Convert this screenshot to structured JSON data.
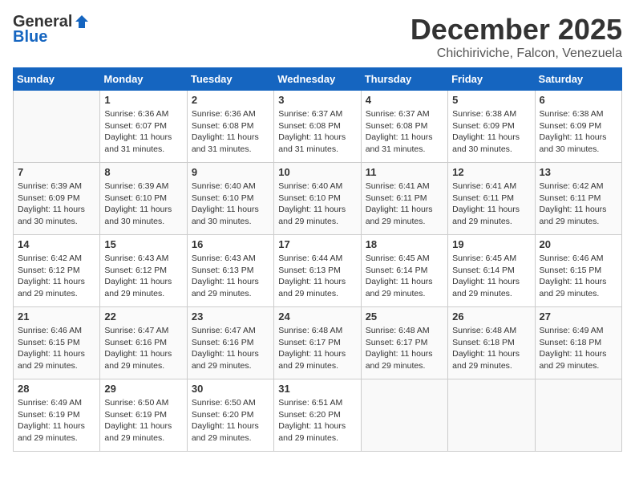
{
  "logo": {
    "general": "General",
    "blue": "Blue"
  },
  "header": {
    "month": "December 2025",
    "location": "Chichiriviche, Falcon, Venezuela"
  },
  "weekdays": [
    "Sunday",
    "Monday",
    "Tuesday",
    "Wednesday",
    "Thursday",
    "Friday",
    "Saturday"
  ],
  "weeks": [
    [
      {
        "day": "",
        "sunrise": "",
        "sunset": "",
        "daylight": ""
      },
      {
        "day": "1",
        "sunrise": "Sunrise: 6:36 AM",
        "sunset": "Sunset: 6:07 PM",
        "daylight": "Daylight: 11 hours and 31 minutes."
      },
      {
        "day": "2",
        "sunrise": "Sunrise: 6:36 AM",
        "sunset": "Sunset: 6:08 PM",
        "daylight": "Daylight: 11 hours and 31 minutes."
      },
      {
        "day": "3",
        "sunrise": "Sunrise: 6:37 AM",
        "sunset": "Sunset: 6:08 PM",
        "daylight": "Daylight: 11 hours and 31 minutes."
      },
      {
        "day": "4",
        "sunrise": "Sunrise: 6:37 AM",
        "sunset": "Sunset: 6:08 PM",
        "daylight": "Daylight: 11 hours and 31 minutes."
      },
      {
        "day": "5",
        "sunrise": "Sunrise: 6:38 AM",
        "sunset": "Sunset: 6:09 PM",
        "daylight": "Daylight: 11 hours and 30 minutes."
      },
      {
        "day": "6",
        "sunrise": "Sunrise: 6:38 AM",
        "sunset": "Sunset: 6:09 PM",
        "daylight": "Daylight: 11 hours and 30 minutes."
      }
    ],
    [
      {
        "day": "7",
        "sunrise": "Sunrise: 6:39 AM",
        "sunset": "Sunset: 6:09 PM",
        "daylight": "Daylight: 11 hours and 30 minutes."
      },
      {
        "day": "8",
        "sunrise": "Sunrise: 6:39 AM",
        "sunset": "Sunset: 6:10 PM",
        "daylight": "Daylight: 11 hours and 30 minutes."
      },
      {
        "day": "9",
        "sunrise": "Sunrise: 6:40 AM",
        "sunset": "Sunset: 6:10 PM",
        "daylight": "Daylight: 11 hours and 30 minutes."
      },
      {
        "day": "10",
        "sunrise": "Sunrise: 6:40 AM",
        "sunset": "Sunset: 6:10 PM",
        "daylight": "Daylight: 11 hours and 29 minutes."
      },
      {
        "day": "11",
        "sunrise": "Sunrise: 6:41 AM",
        "sunset": "Sunset: 6:11 PM",
        "daylight": "Daylight: 11 hours and 29 minutes."
      },
      {
        "day": "12",
        "sunrise": "Sunrise: 6:41 AM",
        "sunset": "Sunset: 6:11 PM",
        "daylight": "Daylight: 11 hours and 29 minutes."
      },
      {
        "day": "13",
        "sunrise": "Sunrise: 6:42 AM",
        "sunset": "Sunset: 6:11 PM",
        "daylight": "Daylight: 11 hours and 29 minutes."
      }
    ],
    [
      {
        "day": "14",
        "sunrise": "Sunrise: 6:42 AM",
        "sunset": "Sunset: 6:12 PM",
        "daylight": "Daylight: 11 hours and 29 minutes."
      },
      {
        "day": "15",
        "sunrise": "Sunrise: 6:43 AM",
        "sunset": "Sunset: 6:12 PM",
        "daylight": "Daylight: 11 hours and 29 minutes."
      },
      {
        "day": "16",
        "sunrise": "Sunrise: 6:43 AM",
        "sunset": "Sunset: 6:13 PM",
        "daylight": "Daylight: 11 hours and 29 minutes."
      },
      {
        "day": "17",
        "sunrise": "Sunrise: 6:44 AM",
        "sunset": "Sunset: 6:13 PM",
        "daylight": "Daylight: 11 hours and 29 minutes."
      },
      {
        "day": "18",
        "sunrise": "Sunrise: 6:45 AM",
        "sunset": "Sunset: 6:14 PM",
        "daylight": "Daylight: 11 hours and 29 minutes."
      },
      {
        "day": "19",
        "sunrise": "Sunrise: 6:45 AM",
        "sunset": "Sunset: 6:14 PM",
        "daylight": "Daylight: 11 hours and 29 minutes."
      },
      {
        "day": "20",
        "sunrise": "Sunrise: 6:46 AM",
        "sunset": "Sunset: 6:15 PM",
        "daylight": "Daylight: 11 hours and 29 minutes."
      }
    ],
    [
      {
        "day": "21",
        "sunrise": "Sunrise: 6:46 AM",
        "sunset": "Sunset: 6:15 PM",
        "daylight": "Daylight: 11 hours and 29 minutes."
      },
      {
        "day": "22",
        "sunrise": "Sunrise: 6:47 AM",
        "sunset": "Sunset: 6:16 PM",
        "daylight": "Daylight: 11 hours and 29 minutes."
      },
      {
        "day": "23",
        "sunrise": "Sunrise: 6:47 AM",
        "sunset": "Sunset: 6:16 PM",
        "daylight": "Daylight: 11 hours and 29 minutes."
      },
      {
        "day": "24",
        "sunrise": "Sunrise: 6:48 AM",
        "sunset": "Sunset: 6:17 PM",
        "daylight": "Daylight: 11 hours and 29 minutes."
      },
      {
        "day": "25",
        "sunrise": "Sunrise: 6:48 AM",
        "sunset": "Sunset: 6:17 PM",
        "daylight": "Daylight: 11 hours and 29 minutes."
      },
      {
        "day": "26",
        "sunrise": "Sunrise: 6:48 AM",
        "sunset": "Sunset: 6:18 PM",
        "daylight": "Daylight: 11 hours and 29 minutes."
      },
      {
        "day": "27",
        "sunrise": "Sunrise: 6:49 AM",
        "sunset": "Sunset: 6:18 PM",
        "daylight": "Daylight: 11 hours and 29 minutes."
      }
    ],
    [
      {
        "day": "28",
        "sunrise": "Sunrise: 6:49 AM",
        "sunset": "Sunset: 6:19 PM",
        "daylight": "Daylight: 11 hours and 29 minutes."
      },
      {
        "day": "29",
        "sunrise": "Sunrise: 6:50 AM",
        "sunset": "Sunset: 6:19 PM",
        "daylight": "Daylight: 11 hours and 29 minutes."
      },
      {
        "day": "30",
        "sunrise": "Sunrise: 6:50 AM",
        "sunset": "Sunset: 6:20 PM",
        "daylight": "Daylight: 11 hours and 29 minutes."
      },
      {
        "day": "31",
        "sunrise": "Sunrise: 6:51 AM",
        "sunset": "Sunset: 6:20 PM",
        "daylight": "Daylight: 11 hours and 29 minutes."
      },
      {
        "day": "",
        "sunrise": "",
        "sunset": "",
        "daylight": ""
      },
      {
        "day": "",
        "sunrise": "",
        "sunset": "",
        "daylight": ""
      },
      {
        "day": "",
        "sunrise": "",
        "sunset": "",
        "daylight": ""
      }
    ]
  ]
}
